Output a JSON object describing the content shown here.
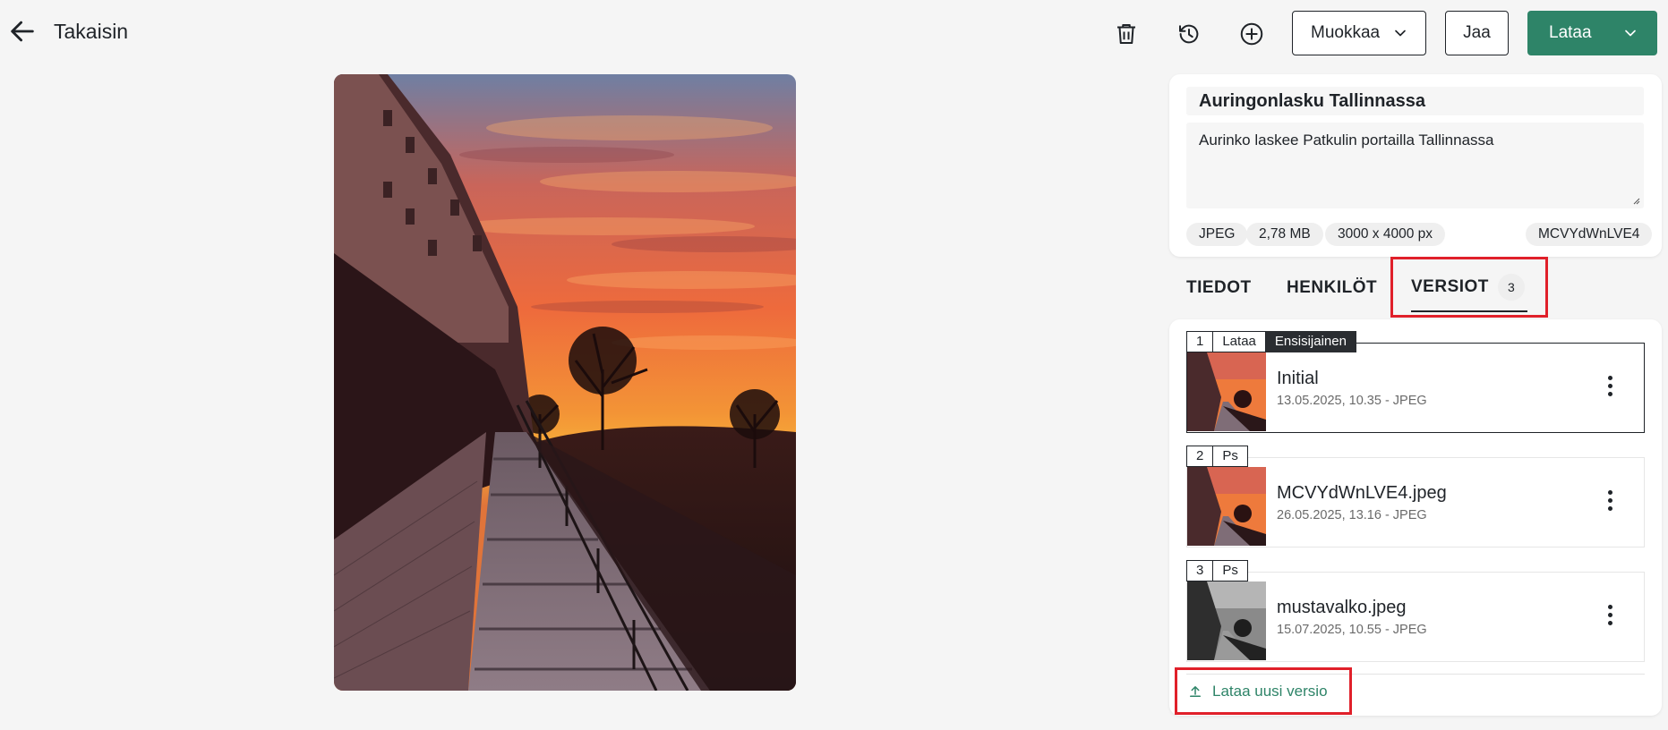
{
  "header": {
    "back_label": "Takaisin",
    "edit_label": "Muokkaa",
    "share_label": "Jaa",
    "download_label": "Lataa"
  },
  "asset": {
    "title": "Auringonlasku Tallinnassa",
    "description": "Aurinko laskee Patkulin portailla Tallinnassa",
    "format": "JPEG",
    "size": "2,78 MB",
    "dimensions": "3000 x 4000 px",
    "id": "MCVYdWnLVE4"
  },
  "tabs": {
    "details": "TIEDOT",
    "people": "HENKILÖT",
    "versions": "VERSIOT",
    "versions_count": "3"
  },
  "versions": [
    {
      "number": "1",
      "tag": "Lataa",
      "badge": "Ensisijainen",
      "name": "Initial",
      "meta": "13.05.2025, 10.35 - JPEG"
    },
    {
      "number": "2",
      "tag": "Ps",
      "name": "MCVYdWnLVE4.jpeg",
      "meta": "26.05.2025, 13.16 - JPEG"
    },
    {
      "number": "3",
      "tag": "Ps",
      "name": "mustavalko.jpeg",
      "meta": "15.07.2025, 10.55 - JPEG"
    }
  ],
  "upload_new_version": "Lataa uusi versio",
  "colors": {
    "primary": "#2e8468",
    "highlight": "#e0202a",
    "text": "#1f2328"
  },
  "icons": [
    "arrow-left-icon",
    "trash-icon",
    "history-icon",
    "plus-circle-icon",
    "chevron-down-icon",
    "kebab-icon",
    "upload-icon"
  ]
}
